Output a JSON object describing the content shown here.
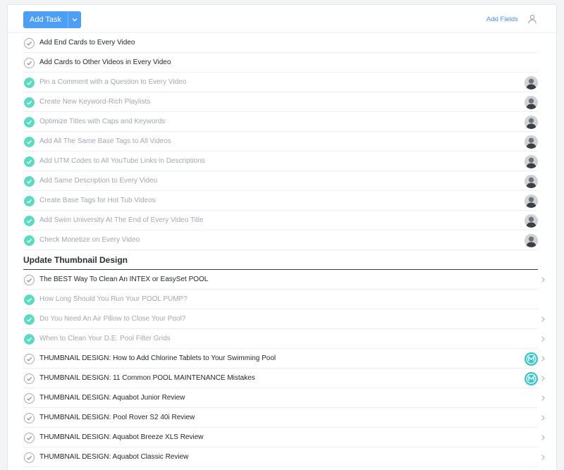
{
  "toolbar": {
    "add_task_label": "Add Task",
    "add_fields_label": "Add Fields",
    "caret_icon": "chevron-down-icon",
    "person_icon": "person-icon",
    "accent": "#4d9ff5"
  },
  "colors": {
    "completed_check": "#5ed9c2",
    "completed_text": "#a3a8ae",
    "incomplete_text": "#1f2328",
    "divider": "#eceef1"
  },
  "tasks": [
    {
      "title": "Add End Cards to Every Video",
      "completed": false,
      "avatar": "none",
      "chevron": false
    },
    {
      "title": "Add Cards to Other Videos in Every Video",
      "completed": false,
      "avatar": "none",
      "chevron": false
    },
    {
      "title": "Pin a Comment with a Question to Every Video",
      "completed": true,
      "avatar": "photo",
      "chevron": false
    },
    {
      "title": "Create New Keyword-Rich Playlists",
      "completed": true,
      "avatar": "photo",
      "chevron": false
    },
    {
      "title": "Optimize Titles with Caps and Keywords",
      "completed": true,
      "avatar": "photo",
      "chevron": false
    },
    {
      "title": "Add All The Same Base Tags to All Videos",
      "completed": true,
      "avatar": "photo",
      "chevron": false
    },
    {
      "title": "Add UTM Codes to All YouTube Links in Descriptions",
      "completed": true,
      "avatar": "photo",
      "chevron": false
    },
    {
      "title": "Add Same Description to Every Video",
      "completed": true,
      "avatar": "photo",
      "chevron": false
    },
    {
      "title": "Create Base Tags for Hot Tub Videos",
      "completed": true,
      "avatar": "photo",
      "chevron": false
    },
    {
      "title": "Add Swim University At The End of Every Video Title",
      "completed": true,
      "avatar": "photo",
      "chevron": false
    },
    {
      "title": "Check Monetize on Every Video",
      "completed": true,
      "avatar": "photo",
      "chevron": false
    }
  ],
  "section": {
    "title": "Update Thumbnail Design",
    "tasks": [
      {
        "title": "The BEST Way To Clean An INTEX or EasySet POOL",
        "completed": false,
        "avatar": "none",
        "chevron": true
      },
      {
        "title": "How Long Should You Run Your POOL PUMP?",
        "completed": true,
        "avatar": "none",
        "chevron": false
      },
      {
        "title": "Do You Need An Air Pillow to Close Your Pool?",
        "completed": true,
        "avatar": "none",
        "chevron": true
      },
      {
        "title": "When to Clean Your D.E. Pool Filter Grids",
        "completed": true,
        "avatar": "none",
        "chevron": true
      },
      {
        "title": "THUMBNAIL DESIGN: How to Add Chlorine Tablets to Your Swimming Pool",
        "completed": false,
        "avatar": "teal",
        "chevron": true
      },
      {
        "title": "THUMBNAIL DESIGN: 11 Common POOL MAINTENANCE Mistakes",
        "completed": false,
        "avatar": "teal",
        "chevron": true
      },
      {
        "title": "THUMBNAIL DESIGN: Aquabot Junior Review",
        "completed": false,
        "avatar": "none",
        "chevron": true
      },
      {
        "title": "THUMBNAIL DESIGN: Pool Rover S2 40i Review",
        "completed": false,
        "avatar": "none",
        "chevron": true
      },
      {
        "title": "THUMBNAIL DESIGN: Aquabot Breeze XLS Review",
        "completed": false,
        "avatar": "none",
        "chevron": true
      },
      {
        "title": "THUMBNAIL DESIGN: Aquabot Classic Review",
        "completed": false,
        "avatar": "none",
        "chevron": true
      }
    ]
  }
}
